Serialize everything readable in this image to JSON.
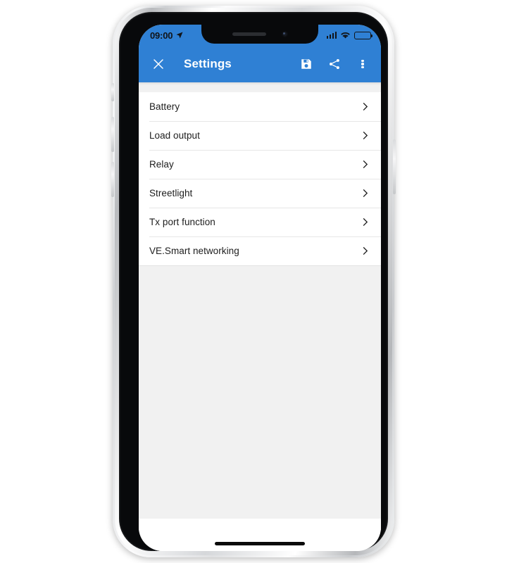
{
  "device": {
    "hardware_buttons": [
      {
        "name": "silent-switch"
      },
      {
        "name": "volume-up-button"
      },
      {
        "name": "volume-down-button"
      },
      {
        "name": "power-button"
      }
    ]
  },
  "status_bar": {
    "time": "09:00",
    "location_icon": "location-arrow-icon",
    "signal_icon": "cellular-signal-icon",
    "wifi_icon": "wifi-icon",
    "battery_icon": "battery-full-icon",
    "background_color": "#2f80d4",
    "foreground_color": "#111418"
  },
  "app_bar": {
    "close_icon": "close-icon",
    "title": "Settings",
    "actions": [
      {
        "name": "save-button",
        "icon": "save-floppy-icon"
      },
      {
        "name": "share-button",
        "icon": "share-icon"
      },
      {
        "name": "overflow-button",
        "icon": "more-vertical-icon"
      }
    ],
    "background_color": "#2f80d4",
    "title_color": "#ffffff"
  },
  "main": {
    "background_color": "#f1f1f1",
    "list_background_color": "#ffffff",
    "settings_items": [
      {
        "label": "Battery",
        "chevron": "chevron-right-icon"
      },
      {
        "label": "Load output",
        "chevron": "chevron-right-icon"
      },
      {
        "label": "Relay",
        "chevron": "chevron-right-icon"
      },
      {
        "label": "Streetlight",
        "chevron": "chevron-right-icon"
      },
      {
        "label": "Tx port function",
        "chevron": "chevron-right-icon"
      },
      {
        "label": "VE.Smart networking",
        "chevron": "chevron-right-icon"
      }
    ]
  },
  "home_indicator": {
    "name": "home-indicator"
  }
}
